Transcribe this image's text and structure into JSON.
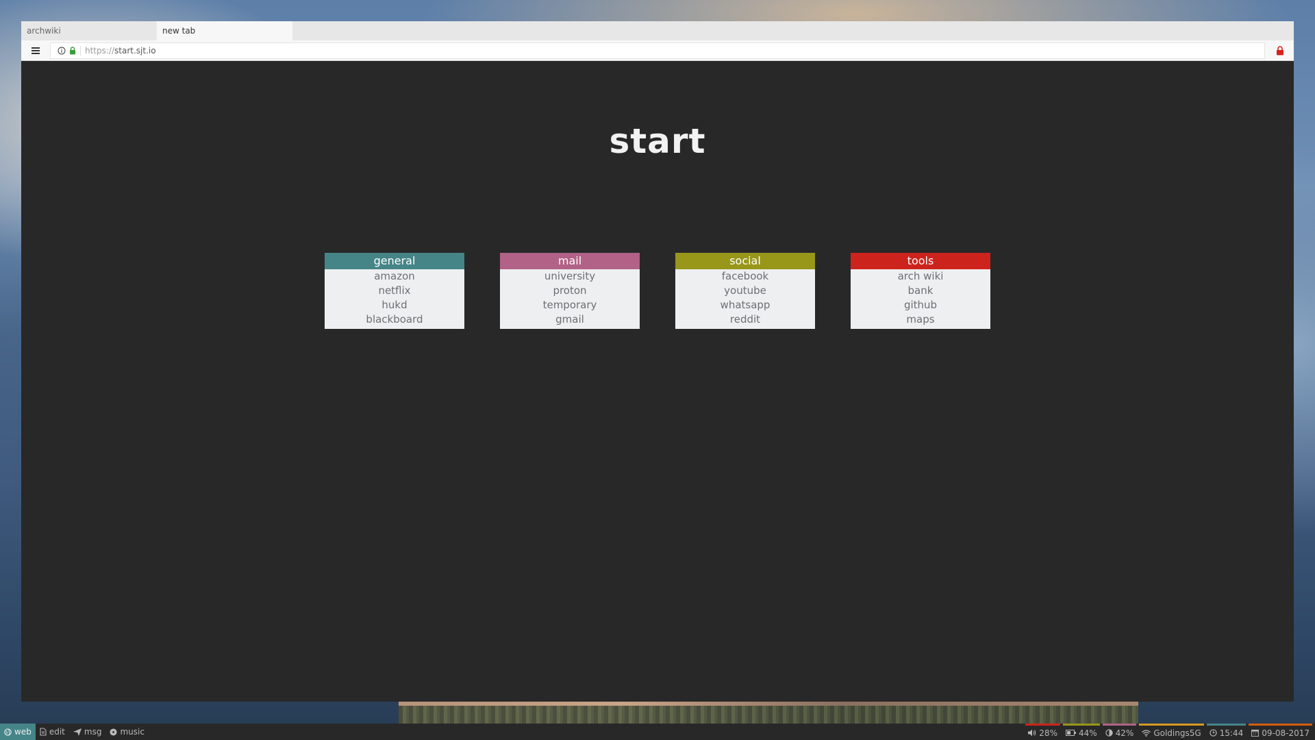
{
  "browser": {
    "tabs": [
      {
        "label": "archwiki"
      },
      {
        "label": "new tab"
      }
    ],
    "url": {
      "scheme": "https://",
      "domain": "start.sjt.io"
    }
  },
  "page": {
    "title": "start",
    "groups": [
      {
        "name": "general",
        "color": "#458588",
        "links": [
          "amazon",
          "netflix",
          "hukd",
          "blackboard"
        ]
      },
      {
        "name": "mail",
        "color": "#b16286",
        "links": [
          "university",
          "proton",
          "temporary",
          "gmail"
        ]
      },
      {
        "name": "social",
        "color": "#98971a",
        "links": [
          "facebook",
          "youtube",
          "whatsapp",
          "reddit"
        ]
      },
      {
        "name": "tools",
        "color": "#cc241d",
        "links": [
          "arch wiki",
          "bank",
          "github",
          "maps"
        ]
      }
    ]
  },
  "taskbar": {
    "workspaces": [
      {
        "label": "web",
        "icon": "globe-icon",
        "active": true
      },
      {
        "label": "edit",
        "icon": "file-icon",
        "active": false
      },
      {
        "label": "msg",
        "icon": "send-icon",
        "active": false
      },
      {
        "label": "music",
        "icon": "disc-icon",
        "active": false
      }
    ],
    "status": {
      "volume": "28%",
      "battery": "44%",
      "brightness": "42%",
      "wifi": "Goldings5G",
      "time": "15:44",
      "date": "09-08-2017"
    },
    "status_colors": {
      "volume": "#cc241d",
      "battery": "#98971a",
      "brightness": "#b16286",
      "wifi": "#d79921",
      "time": "#458588",
      "date": "#d65d0e"
    }
  }
}
